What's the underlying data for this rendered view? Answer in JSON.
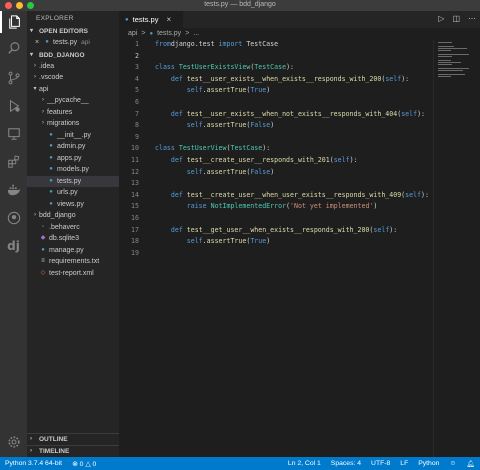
{
  "window": {
    "title": "tests.py — bdd_django"
  },
  "sidebar": {
    "title": "EXPLORER",
    "open_editors_label": "OPEN EDITORS",
    "open_editor": {
      "close": "×",
      "name": "tests.py",
      "desc": "api"
    },
    "project_label": "BDD_DJANGO",
    "tree": [
      {
        "label": ".idea",
        "type": "folder",
        "level": 1,
        "expanded": false
      },
      {
        "label": ".vscode",
        "type": "folder",
        "level": 1,
        "expanded": false
      },
      {
        "label": "api",
        "type": "folder",
        "level": 1,
        "expanded": true
      },
      {
        "label": "__pycache__",
        "type": "folder",
        "level": 2,
        "expanded": false
      },
      {
        "label": "features",
        "type": "folder",
        "level": 2,
        "expanded": false
      },
      {
        "label": "migrations",
        "type": "folder",
        "level": 2,
        "expanded": false
      },
      {
        "label": "__init__.py",
        "type": "py",
        "level": 2
      },
      {
        "label": "admin.py",
        "type": "py",
        "level": 2
      },
      {
        "label": "apps.py",
        "type": "py",
        "level": 2
      },
      {
        "label": "models.py",
        "type": "py",
        "level": 2
      },
      {
        "label": "tests.py",
        "type": "py",
        "level": 2,
        "selected": true
      },
      {
        "label": "urls.py",
        "type": "py",
        "level": 2
      },
      {
        "label": "views.py",
        "type": "py",
        "level": 2
      },
      {
        "label": "bdd_django",
        "type": "folder",
        "level": 1,
        "expanded": false
      },
      {
        "label": ".behaverc",
        "type": "cfg",
        "level": 1
      },
      {
        "label": "db.sqlite3",
        "type": "db",
        "level": 1
      },
      {
        "label": "manage.py",
        "type": "py",
        "level": 1
      },
      {
        "label": "requirements.txt",
        "type": "txt",
        "level": 1
      },
      {
        "label": "test-report.xml",
        "type": "xml",
        "level": 1
      }
    ],
    "outline_label": "OUTLINE",
    "timeline_label": "TIMELINE"
  },
  "tabs": [
    {
      "label": "tests.py",
      "close": "×"
    }
  ],
  "breadcrumb": {
    "folder": "api",
    "sep1": ">",
    "file": "tests.py",
    "sep2": ">",
    "more": "..."
  },
  "editor": {
    "lines": [
      {
        "n": "1",
        "tokens": [
          [
            "kw",
            "from"
          ],
          [
            "",
            "django.test "
          ],
          [
            "kw",
            "import"
          ],
          [
            "",
            " TestCase"
          ]
        ]
      },
      {
        "n": "2",
        "tokens": []
      },
      {
        "n": "3",
        "tokens": [
          [
            "kw",
            "class"
          ],
          [
            "",
            " "
          ],
          [
            "cls",
            "TestUserExistsView"
          ],
          [
            "",
            "("
          ],
          [
            "cls",
            "TestCase"
          ],
          [
            "",
            "):"
          ]
        ]
      },
      {
        "n": "4",
        "tokens": [
          [
            "",
            "    "
          ],
          [
            "kw",
            "def"
          ],
          [
            "",
            " "
          ],
          [
            "fn",
            "test__user_exists__when_exists__responds_with_200"
          ],
          [
            "",
            "("
          ],
          [
            "self",
            "self"
          ],
          [
            "",
            "):"
          ]
        ]
      },
      {
        "n": "5",
        "tokens": [
          [
            "",
            "        "
          ],
          [
            "self",
            "self"
          ],
          [
            "",
            "."
          ],
          [
            "fn",
            "assertTrue"
          ],
          [
            "",
            "("
          ],
          [
            "kw",
            "True"
          ],
          [
            "",
            ")"
          ]
        ]
      },
      {
        "n": "6",
        "tokens": []
      },
      {
        "n": "7",
        "tokens": [
          [
            "",
            "    "
          ],
          [
            "kw",
            "def"
          ],
          [
            "",
            " "
          ],
          [
            "fn",
            "test__user_exists__when_not_exists__responds_with_404"
          ],
          [
            "",
            "("
          ],
          [
            "self",
            "self"
          ],
          [
            "",
            "):"
          ]
        ]
      },
      {
        "n": "8",
        "tokens": [
          [
            "",
            "        "
          ],
          [
            "self",
            "self"
          ],
          [
            "",
            "."
          ],
          [
            "fn",
            "assertTrue"
          ],
          [
            "",
            "("
          ],
          [
            "kw",
            "False"
          ],
          [
            "",
            ")"
          ]
        ]
      },
      {
        "n": "9",
        "tokens": []
      },
      {
        "n": "10",
        "tokens": [
          [
            "kw",
            "class"
          ],
          [
            "",
            " "
          ],
          [
            "cls",
            "TestUserView"
          ],
          [
            "",
            "("
          ],
          [
            "cls",
            "TestCase"
          ],
          [
            "",
            "):"
          ]
        ]
      },
      {
        "n": "11",
        "tokens": [
          [
            "",
            "    "
          ],
          [
            "kw",
            "def"
          ],
          [
            "",
            " "
          ],
          [
            "fn",
            "test__create_user__responds_with_201"
          ],
          [
            "",
            "("
          ],
          [
            "self",
            "self"
          ],
          [
            "",
            "):"
          ]
        ]
      },
      {
        "n": "12",
        "tokens": [
          [
            "",
            "        "
          ],
          [
            "self",
            "self"
          ],
          [
            "",
            "."
          ],
          [
            "fn",
            "assertTrue"
          ],
          [
            "",
            "("
          ],
          [
            "kw",
            "False"
          ],
          [
            "",
            ")"
          ]
        ]
      },
      {
        "n": "13",
        "tokens": []
      },
      {
        "n": "14",
        "tokens": [
          [
            "",
            "    "
          ],
          [
            "kw",
            "def"
          ],
          [
            "",
            " "
          ],
          [
            "fn",
            "test__create_user__when_user_exists__responds_with_409"
          ],
          [
            "",
            "("
          ],
          [
            "self",
            "self"
          ],
          [
            "",
            "):"
          ]
        ]
      },
      {
        "n": "15",
        "tokens": [
          [
            "",
            "        "
          ],
          [
            "kw",
            "raise"
          ],
          [
            "",
            " "
          ],
          [
            "cls",
            "NotImplementedError"
          ],
          [
            "",
            "("
          ],
          [
            "str",
            "'Not yet implemented'"
          ],
          [
            "",
            ")"
          ]
        ]
      },
      {
        "n": "16",
        "tokens": []
      },
      {
        "n": "17",
        "tokens": [
          [
            "",
            "    "
          ],
          [
            "kw",
            "def"
          ],
          [
            "",
            " "
          ],
          [
            "fn",
            "test__get_user__when_exists__responds_with_200"
          ],
          [
            "",
            "("
          ],
          [
            "self",
            "self"
          ],
          [
            "",
            "):"
          ]
        ]
      },
      {
        "n": "18",
        "tokens": [
          [
            "",
            "        "
          ],
          [
            "self",
            "self"
          ],
          [
            "",
            "."
          ],
          [
            "fn",
            "assertTrue"
          ],
          [
            "",
            "("
          ],
          [
            "kw",
            "True"
          ],
          [
            "",
            ")"
          ]
        ]
      },
      {
        "n": "19",
        "tokens": []
      }
    ]
  },
  "statusbar": {
    "python_version": "Python 3.7.4 64-bit",
    "errors": "0",
    "warnings": "0",
    "position": "Ln 2, Col 1",
    "spaces": "Spaces: 4",
    "encoding": "UTF-8",
    "eol": "LF",
    "language": "Python"
  },
  "colors": {
    "accent": "#007acc",
    "editor_bg": "#1e1e1e",
    "sidebar_bg": "#252526",
    "activity_bg": "#333333"
  },
  "icons": [
    "files-icon",
    "search-icon",
    "source-control-icon",
    "run-debug-icon",
    "remote-explorer-icon",
    "extensions-icon",
    "docker-icon",
    "github-icon",
    "django-icon",
    "settings-gear-icon"
  ]
}
